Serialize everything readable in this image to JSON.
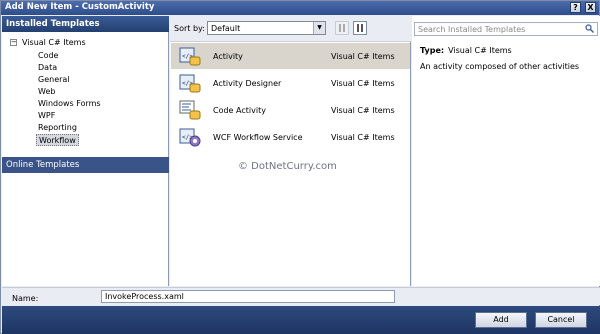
{
  "window": {
    "title": "Add New Item - CustomActivity",
    "help_label": "?",
    "close_label": "X"
  },
  "left": {
    "installed_header": "Installed Templates",
    "tree_root": "Visual C# Items",
    "tree_toggle": "−",
    "tree_items": [
      "Code",
      "Data",
      "General",
      "Web",
      "Windows Forms",
      "WPF",
      "Reporting",
      "Workflow"
    ],
    "selected_item": "Workflow",
    "online_header": "Online Templates"
  },
  "middle": {
    "sort_label": "Sort by:",
    "sort_value": "Default",
    "templates": [
      {
        "name": "Activity",
        "category": "Visual C# Items",
        "icon": "activity-icon",
        "selected": true
      },
      {
        "name": "Activity Designer",
        "category": "Visual C# Items",
        "icon": "activity-designer-icon",
        "selected": false
      },
      {
        "name": "Code Activity",
        "category": "Visual C# Items",
        "icon": "code-activity-icon",
        "selected": false
      },
      {
        "name": "WCF Workflow Service",
        "category": "Visual C# Items",
        "icon": "wcf-service-icon",
        "selected": false
      }
    ]
  },
  "right": {
    "search_placeholder": "Search Installed Templates",
    "type_label": "Type:",
    "type_value": "Visual C# Items",
    "description": "An activity composed of other activities"
  },
  "watermark": "© DotNetCurry.com",
  "bottom": {
    "name_label": "Name:",
    "name_value": "InvokeProcess.xaml",
    "add_label": "Add",
    "cancel_label": "Cancel"
  },
  "colors": {
    "title_bar": "#2d4d8c",
    "selected_row": "#d9d5cd",
    "header": "#243f70"
  }
}
